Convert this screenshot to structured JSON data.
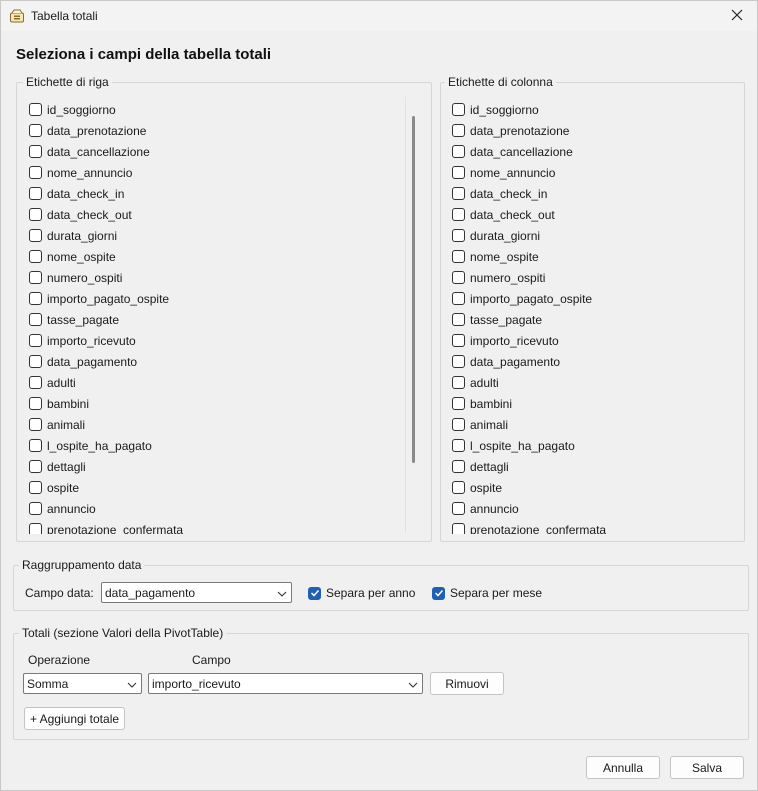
{
  "window": {
    "title": "Tabella totali"
  },
  "heading": "Seleziona i campi della tabella totali",
  "row_labels": {
    "legend": "Etichette di riga",
    "items": [
      {
        "label": "id_soggiorno",
        "checked": false
      },
      {
        "label": "data_prenotazione",
        "checked": false
      },
      {
        "label": "data_cancellazione",
        "checked": false
      },
      {
        "label": "nome_annuncio",
        "checked": false
      },
      {
        "label": "data_check_in",
        "checked": false
      },
      {
        "label": "data_check_out",
        "checked": false
      },
      {
        "label": "durata_giorni",
        "checked": false
      },
      {
        "label": "nome_ospite",
        "checked": false
      },
      {
        "label": "numero_ospiti",
        "checked": false
      },
      {
        "label": "importo_pagato_ospite",
        "checked": false
      },
      {
        "label": "tasse_pagate",
        "checked": false
      },
      {
        "label": "importo_ricevuto",
        "checked": false
      },
      {
        "label": "data_pagamento",
        "checked": false
      },
      {
        "label": "adulti",
        "checked": false
      },
      {
        "label": "bambini",
        "checked": false
      },
      {
        "label": "animali",
        "checked": false
      },
      {
        "label": "l_ospite_ha_pagato",
        "checked": false
      },
      {
        "label": "dettagli",
        "checked": false
      },
      {
        "label": "ospite",
        "checked": false
      },
      {
        "label": "annuncio",
        "checked": false
      },
      {
        "label": "prenotazione_confermata",
        "checked": false
      }
    ]
  },
  "column_labels": {
    "legend": "Etichette di colonna",
    "items": [
      {
        "label": "id_soggiorno",
        "checked": false
      },
      {
        "label": "data_prenotazione",
        "checked": false
      },
      {
        "label": "data_cancellazione",
        "checked": false
      },
      {
        "label": "nome_annuncio",
        "checked": false
      },
      {
        "label": "data_check_in",
        "checked": false
      },
      {
        "label": "data_check_out",
        "checked": false
      },
      {
        "label": "durata_giorni",
        "checked": false
      },
      {
        "label": "nome_ospite",
        "checked": false
      },
      {
        "label": "numero_ospiti",
        "checked": false
      },
      {
        "label": "importo_pagato_ospite",
        "checked": false
      },
      {
        "label": "tasse_pagate",
        "checked": false
      },
      {
        "label": "importo_ricevuto",
        "checked": false
      },
      {
        "label": "data_pagamento",
        "checked": false
      },
      {
        "label": "adulti",
        "checked": false
      },
      {
        "label": "bambini",
        "checked": false
      },
      {
        "label": "animali",
        "checked": false
      },
      {
        "label": "l_ospite_ha_pagato",
        "checked": false
      },
      {
        "label": "dettagli",
        "checked": false
      },
      {
        "label": "ospite",
        "checked": false
      },
      {
        "label": "annuncio",
        "checked": false
      },
      {
        "label": "prenotazione_confermata",
        "checked": false
      }
    ]
  },
  "date_grouping": {
    "legend": "Raggruppamento data",
    "field_label": "Campo data:",
    "field_value": "data_pagamento",
    "split_year_label": "Separa per anno",
    "split_year_checked": true,
    "split_month_label": "Separa per mese",
    "split_month_checked": true
  },
  "totals": {
    "legend": "Totali (sezione Valori della PivotTable)",
    "operation_header": "Operazione",
    "field_header": "Campo",
    "operation_value": "Somma",
    "field_value": "importo_ricevuto",
    "remove_label": "Rimuovi",
    "add_label": "+ Aggiungi totale"
  },
  "footer": {
    "cancel_label": "Annulla",
    "save_label": "Salva"
  },
  "colors": {
    "accent": "#1f5fb4",
    "background": "#f0f0f0"
  }
}
